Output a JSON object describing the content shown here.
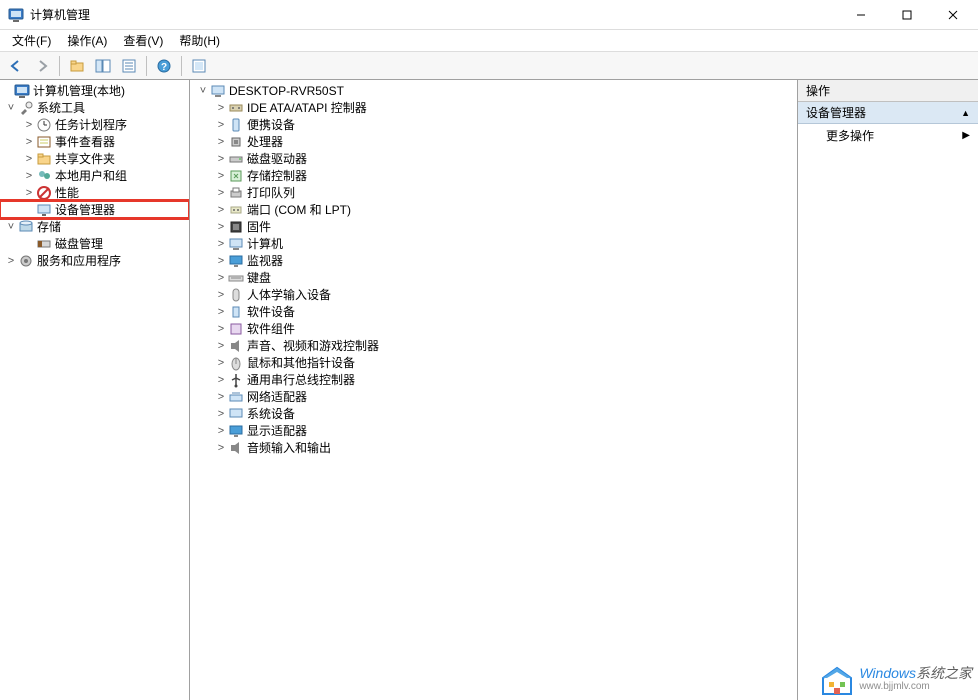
{
  "title": "计算机管理",
  "menus": [
    "文件(F)",
    "操作(A)",
    "查看(V)",
    "帮助(H)"
  ],
  "toolbar_icons": [
    "back-icon",
    "forward-icon",
    "up-icon",
    "show-hide-tree-icon",
    "properties-icon",
    "help-icon",
    "refresh-icon"
  ],
  "left_tree": {
    "root": "计算机管理(本地)",
    "items": [
      {
        "label": "系统工具",
        "expanded": true,
        "icon": "tools-icon",
        "children": [
          {
            "label": "任务计划程序",
            "icon": "task-scheduler-icon",
            "expander": ">"
          },
          {
            "label": "事件查看器",
            "icon": "event-viewer-icon",
            "expander": ">"
          },
          {
            "label": "共享文件夹",
            "icon": "shared-folders-icon",
            "expander": ">"
          },
          {
            "label": "本地用户和组",
            "icon": "users-groups-icon",
            "expander": ">"
          },
          {
            "label": "性能",
            "icon": "performance-icon",
            "expander": ">"
          },
          {
            "label": "设备管理器",
            "icon": "device-manager-icon",
            "expander": "",
            "highlighted": true
          }
        ]
      },
      {
        "label": "存储",
        "expanded": true,
        "icon": "storage-icon",
        "children": [
          {
            "label": "磁盘管理",
            "icon": "disk-mgmt-icon",
            "expander": ""
          }
        ]
      },
      {
        "label": "服务和应用程序",
        "expanded": false,
        "icon": "services-icon",
        "expander": ">"
      }
    ]
  },
  "center_tree": {
    "root": "DESKTOP-RVR50ST",
    "items": [
      {
        "label": "IDE ATA/ATAPI 控制器",
        "icon": "ide-icon"
      },
      {
        "label": "便携设备",
        "icon": "portable-icon"
      },
      {
        "label": "处理器",
        "icon": "cpu-icon"
      },
      {
        "label": "磁盘驱动器",
        "icon": "disk-icon"
      },
      {
        "label": "存储控制器",
        "icon": "storage-ctrl-icon"
      },
      {
        "label": "打印队列",
        "icon": "printer-icon"
      },
      {
        "label": "端口 (COM 和 LPT)",
        "icon": "port-icon"
      },
      {
        "label": "固件",
        "icon": "firmware-icon"
      },
      {
        "label": "计算机",
        "icon": "computer-icon"
      },
      {
        "label": "监视器",
        "icon": "monitor-icon"
      },
      {
        "label": "键盘",
        "icon": "keyboard-icon"
      },
      {
        "label": "人体学输入设备",
        "icon": "hid-icon"
      },
      {
        "label": "软件设备",
        "icon": "software-dev-icon"
      },
      {
        "label": "软件组件",
        "icon": "software-comp-icon"
      },
      {
        "label": "声音、视频和游戏控制器",
        "icon": "sound-icon"
      },
      {
        "label": "鼠标和其他指针设备",
        "icon": "mouse-icon"
      },
      {
        "label": "通用串行总线控制器",
        "icon": "usb-icon"
      },
      {
        "label": "网络适配器",
        "icon": "network-icon"
      },
      {
        "label": "系统设备",
        "icon": "system-icon"
      },
      {
        "label": "显示适配器",
        "icon": "display-icon"
      },
      {
        "label": "音频输入和输出",
        "icon": "audio-io-icon"
      }
    ]
  },
  "actions": {
    "header": "操作",
    "section": "设备管理器",
    "more": "更多操作"
  },
  "watermark": {
    "brand_a": "Windows",
    "brand_b": "系统之家",
    "url": "www.bjjmlv.com"
  }
}
